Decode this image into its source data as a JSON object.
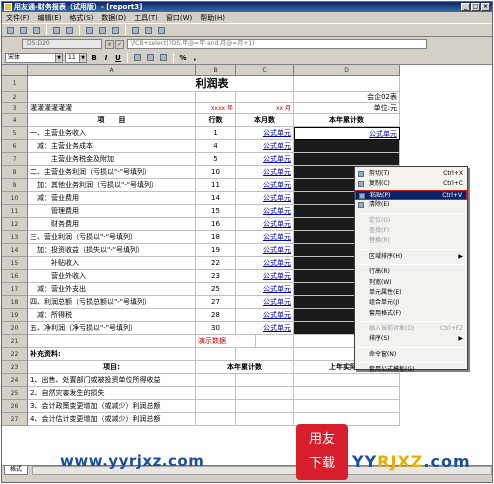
{
  "window": {
    "title": "用友通-财务报表（试用版）- [report3]"
  },
  "menubar": {
    "items": [
      "文件(F)",
      "编辑(E)",
      "格式(S)",
      "数据(D)",
      "工具(T)",
      "窗口(W)",
      "帮助(H)"
    ]
  },
  "formula_bar": {
    "cell_ref": "D5:D20",
    "formula": "\\fCB+select(?D5,年@=年 and 月@=月+1)"
  },
  "format_toolbar": {
    "font": "宋体",
    "size": "11",
    "bold": "B",
    "italic": "I",
    "underline": "U"
  },
  "sheet": {
    "columns": [
      "A",
      "B",
      "C",
      "D"
    ],
    "rows": [
      {
        "num": "1",
        "a": "",
        "b": "利润表",
        "c": "",
        "d": ""
      },
      {
        "num": "2",
        "a": "",
        "b": "",
        "c": "",
        "d": "会企02表"
      },
      {
        "num": "3",
        "a": "灌灌灌灌灌灌",
        "b": "xxxx 年",
        "c": "xx 月",
        "d": "单位:元"
      },
      {
        "num": "4",
        "a": "项　　目",
        "b": "行数",
        "c": "本月数",
        "d": "本年累计数"
      },
      {
        "num": "5",
        "a": "一、主营业务收入",
        "b": "1",
        "c": "公式单元",
        "d": "公式单元"
      },
      {
        "num": "6",
        "a": "　减：主营业务成本",
        "b": "4",
        "c": "公式单元",
        "d": ""
      },
      {
        "num": "7",
        "a": "　　　主营业务税金及附加",
        "b": "5",
        "c": "公式单元",
        "d": ""
      },
      {
        "num": "8",
        "a": "二、主营业务利润（亏损以\"-\"号填列）",
        "b": "10",
        "c": "公式单元",
        "d": ""
      },
      {
        "num": "9",
        "a": "　加：其他业务利润（亏损以\"-\"号填列）",
        "b": "11",
        "c": "公式单元",
        "d": ""
      },
      {
        "num": "10",
        "a": "　减：营业费用",
        "b": "14",
        "c": "公式单元",
        "d": ""
      },
      {
        "num": "11",
        "a": "　　　管理费用",
        "b": "15",
        "c": "公式单元",
        "d": ""
      },
      {
        "num": "12",
        "a": "　　　财务费用",
        "b": "16",
        "c": "公式单元",
        "d": ""
      },
      {
        "num": "13",
        "a": "三、营业利润（亏损以\"-\"号填列）",
        "b": "18",
        "c": "公式单元",
        "d": ""
      },
      {
        "num": "14",
        "a": "　加：投资收益（损失以\"-\"号填列）",
        "b": "19",
        "c": "公式单元",
        "d": ""
      },
      {
        "num": "15",
        "a": "　　　补贴收入",
        "b": "22",
        "c": "公式单元",
        "d": ""
      },
      {
        "num": "16",
        "a": "　　　营业外收入",
        "b": "23",
        "c": "公式单元",
        "d": ""
      },
      {
        "num": "17",
        "a": "　减：营业外支出",
        "b": "25",
        "c": "公式单元",
        "d": ""
      },
      {
        "num": "18",
        "a": "四、利润总额（亏损总额以\"-\"号填列）",
        "b": "27",
        "c": "公式单元",
        "d": ""
      },
      {
        "num": "19",
        "a": "　减：所得税",
        "b": "28",
        "c": "公式单元",
        "d": ""
      },
      {
        "num": "20",
        "a": "五、净利润（净亏损以\"-\"号填列）",
        "b": "30",
        "c": "公式单元",
        "d": ""
      },
      {
        "num": "21",
        "a": "",
        "b": "演示数据",
        "c": "",
        "d": ""
      },
      {
        "num": "22",
        "a": "补充资料:",
        "b": "",
        "c": "",
        "d": ""
      },
      {
        "num": "23",
        "a": "项目:",
        "b": "本年累计数",
        "c": "",
        "d": "上年实际数"
      },
      {
        "num": "24",
        "a": "1、出售、处置部门或被投资单位所得收益",
        "b": "",
        "c": "",
        "d": ""
      },
      {
        "num": "25",
        "a": "2、自然灾害发生的损失",
        "b": "",
        "c": "",
        "d": ""
      },
      {
        "num": "26",
        "a": "3、会计政策变更增加（或减少）利润总额",
        "b": "",
        "c": "",
        "d": ""
      },
      {
        "num": "27",
        "a": "4、会计估计变更增加（或减少）利润总额",
        "b": "",
        "c": "",
        "d": ""
      }
    ]
  },
  "context_menu": {
    "items": [
      {
        "label": "剪切(T)",
        "shortcut": "Ctrl+X",
        "state": "normal"
      },
      {
        "label": "复制(C)",
        "shortcut": "Ctrl+C",
        "state": "normal"
      },
      {
        "label": "粘贴(P)",
        "shortcut": "Ctrl+V",
        "state": "selected"
      },
      {
        "label": "清除(E)",
        "shortcut": "",
        "state": "normal"
      },
      {
        "label": "---"
      },
      {
        "label": "定位(G)",
        "shortcut": "",
        "state": "disabled"
      },
      {
        "label": "查找(F)",
        "shortcut": "",
        "state": "disabled"
      },
      {
        "label": "替换(R)",
        "shortcut": "",
        "state": "disabled"
      },
      {
        "label": "---"
      },
      {
        "label": "区域排序(H)",
        "shortcut": "▶",
        "state": "normal"
      },
      {
        "label": "---"
      },
      {
        "label": "行高(R)",
        "shortcut": "",
        "state": "normal"
      },
      {
        "label": "列宽(W)",
        "shortcut": "",
        "state": "normal"
      },
      {
        "label": "单元属性(E)",
        "shortcut": "",
        "state": "normal"
      },
      {
        "label": "组合单元(J)",
        "shortcut": "",
        "state": "normal"
      },
      {
        "label": "套用格式(F)",
        "shortcut": "",
        "state": "normal"
      },
      {
        "label": "---"
      },
      {
        "label": "插入当前对象(O)",
        "shortcut": "Ctrl+F2",
        "state": "disabled"
      },
      {
        "label": "排序(S)",
        "shortcut": "▶",
        "state": "normal"
      },
      {
        "label": "---"
      },
      {
        "label": "命令窗(N)",
        "shortcut": "",
        "state": "normal"
      },
      {
        "label": "---"
      },
      {
        "label": "套用公式模板(G)",
        "shortcut": "",
        "state": "normal"
      }
    ]
  },
  "sheet_tab": "格式",
  "watermarks": {
    "url_left": "www.yyrjxz.com",
    "logo_line1": "用友",
    "logo_line2": "下载",
    "url_right_a": "YY",
    "url_right_b": "RJXZ",
    "url_right_c": ".com"
  }
}
